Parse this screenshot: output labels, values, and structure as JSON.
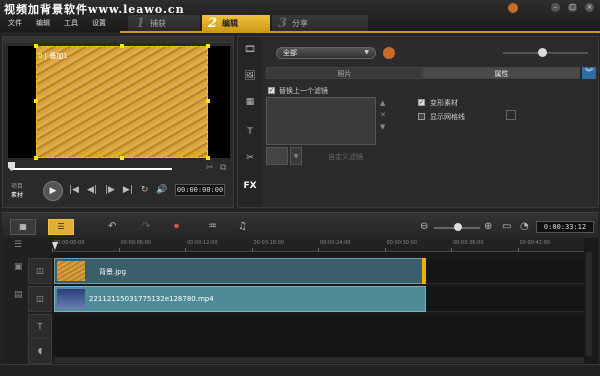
{
  "app": {
    "watermark": "视频加背景软件www.leawo.cn",
    "menu": [
      "文件",
      "编辑",
      "工具",
      "设置"
    ],
    "steps": [
      {
        "num": "1",
        "label": "捕获"
      },
      {
        "num": "2",
        "label": "编辑"
      },
      {
        "num": "3",
        "label": "分享"
      }
    ]
  },
  "preview": {
    "overlay_label": "0 | 叠加1",
    "project_label": "项目",
    "clip_label": "素材",
    "timecode": "00:00:00:00",
    "transport": [
      "|◀",
      "◀|",
      "|▶",
      "▶|",
      "↻",
      "🔊"
    ]
  },
  "options": {
    "dropdown_value": "全部",
    "subtabs": [
      "照片",
      "属性"
    ],
    "active_subtab": 1,
    "replace_last_filter": "替换上一个滤镜",
    "distort_clip": "变形素材",
    "show_grid": "显示网格线",
    "custom_filter": "自定义滤镜",
    "tools": [
      "🎞",
      "🖼",
      "▦",
      "T",
      "✂",
      "FX"
    ]
  },
  "timeline": {
    "timecode": "0:00:33:12",
    "ticks": [
      "00:00:00:00",
      "00:00:06:00",
      "00:00:12:00",
      "00:00:18:00",
      "00:00:24:00",
      "00:00:30:00",
      "00:00:36:00",
      "00:00:42:00"
    ],
    "clips": [
      {
        "name": "背景.jpg"
      },
      {
        "name": "22112115031775132e128780.mp4"
      }
    ]
  },
  "colors": {
    "accent": "#e0b036",
    "clip_photo": "#3a5f6a",
    "clip_video": "#4f8a98",
    "track_endcap": "#f0b000"
  }
}
